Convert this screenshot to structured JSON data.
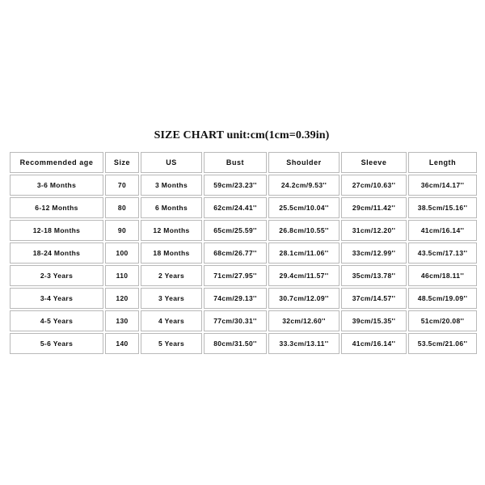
{
  "document": {
    "title": "SIZE CHART unit:cm(1cm=0.39in)",
    "background_color": "#ffffff",
    "text_color": "#0d0d0d",
    "border_color": "#b9b9b9"
  },
  "chart_data": {
    "type": "table",
    "title": "SIZE CHART unit:cm(1cm=0.39in)",
    "columns": [
      "Recommended age",
      "Size",
      "US",
      "Bust",
      "Shoulder",
      "Sleeve",
      "Length"
    ],
    "rows": [
      [
        "3-6 Months",
        "70",
        "3 Months",
        "59cm/23.23''",
        "24.2cm/9.53''",
        "27cm/10.63''",
        "36cm/14.17''"
      ],
      [
        "6-12 Months",
        "80",
        "6 Months",
        "62cm/24.41''",
        "25.5cm/10.04''",
        "29cm/11.42''",
        "38.5cm/15.16''"
      ],
      [
        "12-18 Months",
        "90",
        "12 Months",
        "65cm/25.59''",
        "26.8cm/10.55''",
        "31cm/12.20''",
        "41cm/16.14''"
      ],
      [
        "18-24 Months",
        "100",
        "18 Months",
        "68cm/26.77''",
        "28.1cm/11.06''",
        "33cm/12.99''",
        "43.5cm/17.13''"
      ],
      [
        "2-3 Years",
        "110",
        "2 Years",
        "71cm/27.95''",
        "29.4cm/11.57''",
        "35cm/13.78''",
        "46cm/18.11''"
      ],
      [
        "3-4 Years",
        "120",
        "3 Years",
        "74cm/29.13''",
        "30.7cm/12.09''",
        "37cm/14.57''",
        "48.5cm/19.09''"
      ],
      [
        "4-5 Years",
        "130",
        "4 Years",
        "77cm/30.31''",
        "32cm/12.60''",
        "39cm/15.35''",
        "51cm/20.08''"
      ],
      [
        "5-6 Years",
        "140",
        "5 Years",
        "80cm/31.50''",
        "33.3cm/13.11''",
        "41cm/16.14''",
        "53.5cm/21.06''"
      ]
    ]
  }
}
